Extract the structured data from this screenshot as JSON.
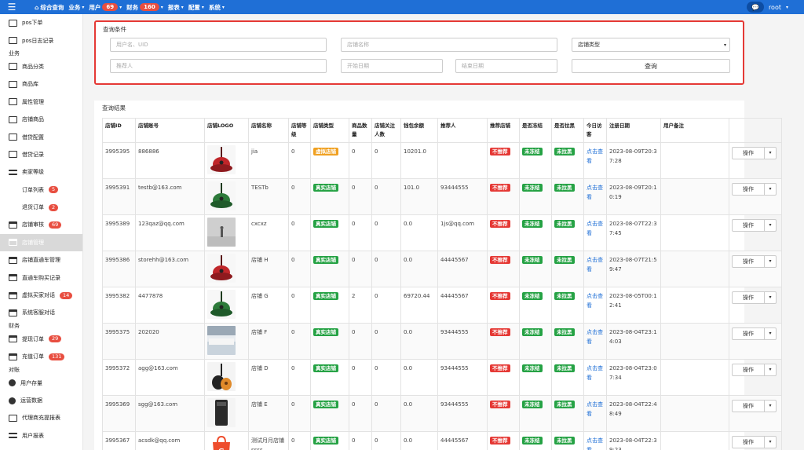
{
  "top_nav": {
    "items": [
      {
        "label": "综合查询",
        "badge": "",
        "caret": false
      },
      {
        "label": "业务",
        "badge": "",
        "caret": true
      },
      {
        "label": "用户",
        "badge": "69",
        "caret": true
      },
      {
        "label": "财务",
        "badge": "160",
        "caret": true
      },
      {
        "label": "报表",
        "badge": "",
        "caret": true
      },
      {
        "label": "配置",
        "badge": "",
        "caret": true
      },
      {
        "label": "系统",
        "badge": "",
        "caret": true
      }
    ],
    "user": "root"
  },
  "sidebar": {
    "items": [
      {
        "type": "item",
        "label": "pos下单",
        "icon": "book-icon"
      },
      {
        "type": "item",
        "label": "pos日志记录",
        "icon": "book-icon"
      },
      {
        "type": "section",
        "label": "业务"
      },
      {
        "type": "item",
        "label": "商品分类",
        "icon": "laptop-icon"
      },
      {
        "type": "item",
        "label": "商品库",
        "icon": "book-icon"
      },
      {
        "type": "item",
        "label": "属性管理",
        "icon": "book-icon"
      },
      {
        "type": "item",
        "label": "店铺商品",
        "icon": "book-icon"
      },
      {
        "type": "item",
        "label": "借贷配置",
        "icon": "book-icon"
      },
      {
        "type": "item",
        "label": "借贷记录",
        "icon": "book-icon"
      },
      {
        "type": "item",
        "label": "卖家等级",
        "icon": "list-icon"
      },
      {
        "type": "sub",
        "label": "订单列表",
        "badge": "5"
      },
      {
        "type": "sub",
        "label": "退货订单",
        "badge": "2"
      },
      {
        "type": "item",
        "label": "店铺审核",
        "icon": "card-icon",
        "badge": "69"
      },
      {
        "type": "item",
        "label": "店铺管理",
        "icon": "card-icon",
        "active": true
      },
      {
        "type": "item",
        "label": "店铺直通车管理",
        "icon": "card-icon"
      },
      {
        "type": "item",
        "label": "直通车购买记录",
        "icon": "card-icon"
      },
      {
        "type": "item",
        "label": "虚拟买家对话",
        "icon": "card-icon",
        "badge": "14"
      },
      {
        "type": "item",
        "label": "系统客服对话",
        "icon": "card-icon"
      },
      {
        "type": "section",
        "label": "财务"
      },
      {
        "type": "item",
        "label": "提现订单",
        "icon": "card-icon",
        "badge": "29"
      },
      {
        "type": "item",
        "label": "充值订单",
        "icon": "card-icon",
        "badge": "131"
      },
      {
        "type": "section",
        "label": "对账"
      },
      {
        "type": "item",
        "label": "用户存量",
        "icon": "pie-icon"
      },
      {
        "type": "item",
        "label": "运营数据",
        "icon": "pie-icon"
      },
      {
        "type": "item",
        "label": "代理商充提报表",
        "icon": "sitemap-icon"
      },
      {
        "type": "item",
        "label": "用户报表",
        "icon": "align-icon"
      }
    ]
  },
  "query": {
    "title": "查询条件",
    "username_placeholder": "用户名、UID",
    "shop_name_placeholder": "店铺名称",
    "shop_type_value": "店铺类型",
    "referrer_placeholder": "推荐人",
    "start_date_placeholder": "开始日期",
    "end_date_placeholder": "结束日期",
    "submit_label": "查询"
  },
  "results": {
    "title": "查询结果",
    "columns": [
      "店铺ID",
      "店铺账号",
      "店铺LOGO",
      "店铺名称",
      "店铺等级",
      "店铺类型",
      "商品数量",
      "店铺关注人数",
      "钱包余额",
      "推荐人",
      "推荐店铺",
      "是否冻结",
      "是否拉黑",
      "今日访客",
      "注册日期",
      "用户备注",
      ""
    ],
    "rows": [
      {
        "id": "3995395",
        "account": "886886",
        "logo": "red-guitar",
        "name": "jia",
        "level": "0",
        "type": "虚拟店铺",
        "type_color": "orange",
        "goods": "0",
        "followers": "0",
        "balance": "10201.0",
        "referrer": "",
        "recommend": "不推荐",
        "frozen": "未冻结",
        "blacklist": "未拉黑",
        "visitor_link": "点击查看",
        "date": "2023-08-09T20:37:28",
        "note": "",
        "op": "操作"
      },
      {
        "id": "3995391",
        "account": "testb@163.com",
        "logo": "green-guitar",
        "name": "TESTb",
        "level": "0",
        "type": "真实店铺",
        "type_color": "green",
        "goods": "0",
        "followers": "0",
        "balance": "101.0",
        "referrer": "93444555",
        "recommend": "不推荐",
        "frozen": "未冻结",
        "blacklist": "未拉黑",
        "visitor_link": "点击查看",
        "date": "2023-08-09T20:10:19",
        "note": "",
        "op": "操作"
      },
      {
        "id": "3995389",
        "account": "123qaz@qq.com",
        "logo": "fog-person",
        "name": "cxcxz",
        "level": "0",
        "type": "真实店铺",
        "type_color": "green",
        "goods": "0",
        "followers": "0",
        "balance": "0.0",
        "referrer": "1js@qq.com",
        "recommend": "不推荐",
        "frozen": "未冻结",
        "blacklist": "未拉黑",
        "visitor_link": "点击查看",
        "date": "2023-08-07T22:37:45",
        "note": "",
        "op": "操作"
      },
      {
        "id": "3995386",
        "account": "storehh@163.com",
        "logo": "red-guitar",
        "name": "店铺 H",
        "level": "0",
        "type": "真实店铺",
        "type_color": "green",
        "goods": "0",
        "followers": "0",
        "balance": "0.0",
        "referrer": "44445567",
        "recommend": "不推荐",
        "frozen": "未冻结",
        "blacklist": "未拉黑",
        "visitor_link": "点击查看",
        "date": "2023-08-07T21:59:47",
        "note": "",
        "op": "操作"
      },
      {
        "id": "3995382",
        "account": "4477878",
        "logo": "green-guitar",
        "name": "店铺 G",
        "level": "0",
        "type": "真实店铺",
        "type_color": "green",
        "goods": "2",
        "followers": "0",
        "balance": "69720.44",
        "referrer": "44445567",
        "recommend": "不推荐",
        "frozen": "未冻结",
        "blacklist": "未拉黑",
        "visitor_link": "点击查看",
        "date": "2023-08-05T00:12:41",
        "note": "",
        "op": "操作"
      },
      {
        "id": "3995375",
        "account": "202020",
        "logo": "bedroom",
        "name": "店铺 F",
        "level": "0",
        "type": "真实店铺",
        "type_color": "green",
        "goods": "0",
        "followers": "0",
        "balance": "0.0",
        "referrer": "93444555",
        "recommend": "不推荐",
        "frozen": "未冻结",
        "blacklist": "未拉黑",
        "visitor_link": "点击查看",
        "date": "2023-08-04T23:14:03",
        "note": "",
        "op": "操作"
      },
      {
        "id": "3995372",
        "account": "agg@163.com",
        "logo": "ukulele",
        "name": "店铺 D",
        "level": "0",
        "type": "真实店铺",
        "type_color": "green",
        "goods": "0",
        "followers": "0",
        "balance": "0.0",
        "referrer": "93444555",
        "recommend": "不推荐",
        "frozen": "未冻结",
        "blacklist": "未拉黑",
        "visitor_link": "点击查看",
        "date": "2023-08-04T23:07:34",
        "note": "",
        "op": "操作"
      },
      {
        "id": "3995369",
        "account": "sgg@163.com",
        "logo": "phone",
        "name": "店铺 E",
        "level": "0",
        "type": "真实店铺",
        "type_color": "green",
        "goods": "0",
        "followers": "0",
        "balance": "0.0",
        "referrer": "93444555",
        "recommend": "不推荐",
        "frozen": "未冻结",
        "blacklist": "未拉黑",
        "visitor_link": "点击查看",
        "date": "2023-08-04T22:48:49",
        "note": "",
        "op": "操作"
      },
      {
        "id": "3995367",
        "account": "acsdk@qq.com",
        "logo": "shop-bag",
        "name": "测试月月店铺ssss",
        "level": "0",
        "type": "真实店铺",
        "type_color": "green",
        "goods": "0",
        "followers": "0",
        "balance": "0.0",
        "referrer": "44445567",
        "recommend": "不推荐",
        "frozen": "未冻结",
        "blacklist": "未拉黑",
        "visitor_link": "点击查看",
        "date": "2023-08-04T22:39:23",
        "note": "",
        "op": "操作"
      }
    ]
  },
  "colors": {
    "topbar": "#1f6fd6",
    "highlight_border": "#e53935",
    "tag_green": "#25a244",
    "tag_red": "#e53935",
    "tag_orange": "#f0a020",
    "link": "#1f6fd6"
  }
}
